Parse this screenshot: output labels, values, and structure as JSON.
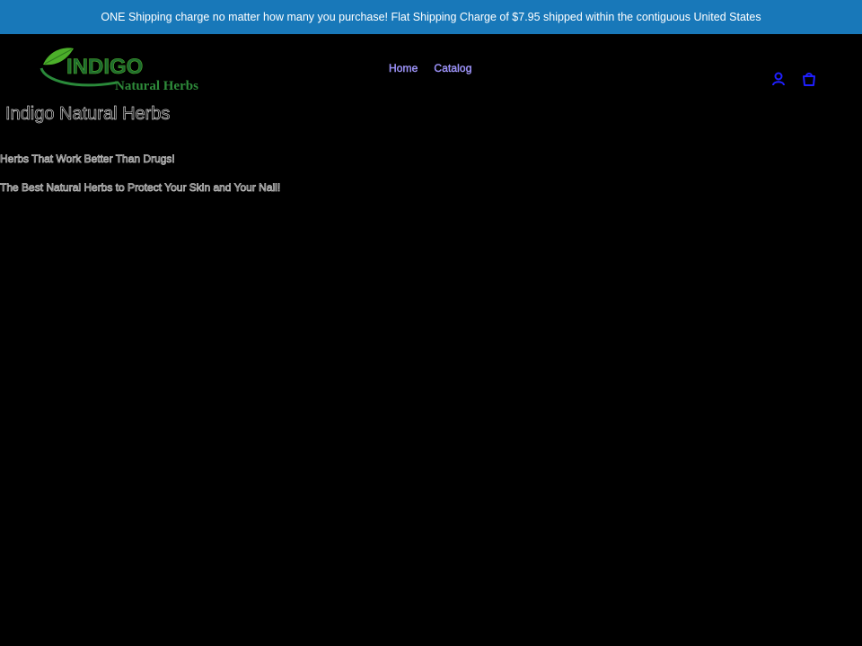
{
  "announcement": {
    "text": "ONE Shipping charge no matter how many you purchase! Flat Shipping Charge of $7.95 shipped within the contiguous United States"
  },
  "logo": {
    "word": "INDIGO",
    "subtitle": "Natural Herbs",
    "colors": {
      "leaf": "#4caf2a",
      "word": "#1e6a2f"
    }
  },
  "nav": {
    "items": [
      {
        "label": "Home"
      },
      {
        "label": "Catalog"
      }
    ]
  },
  "header_icons": {
    "account": "account-icon",
    "cart": "cart-icon",
    "color": "#1f1fff"
  },
  "main": {
    "site_title": "Indigo Natural Herbs",
    "tagline_1": "Herbs That Work Better Than Drugs!",
    "tagline_2": "The Best Natural Herbs to Protect Your Skin and Your Nail!"
  },
  "theme": {
    "announcement_bg": "#1878b9",
    "page_bg": "#000000"
  }
}
